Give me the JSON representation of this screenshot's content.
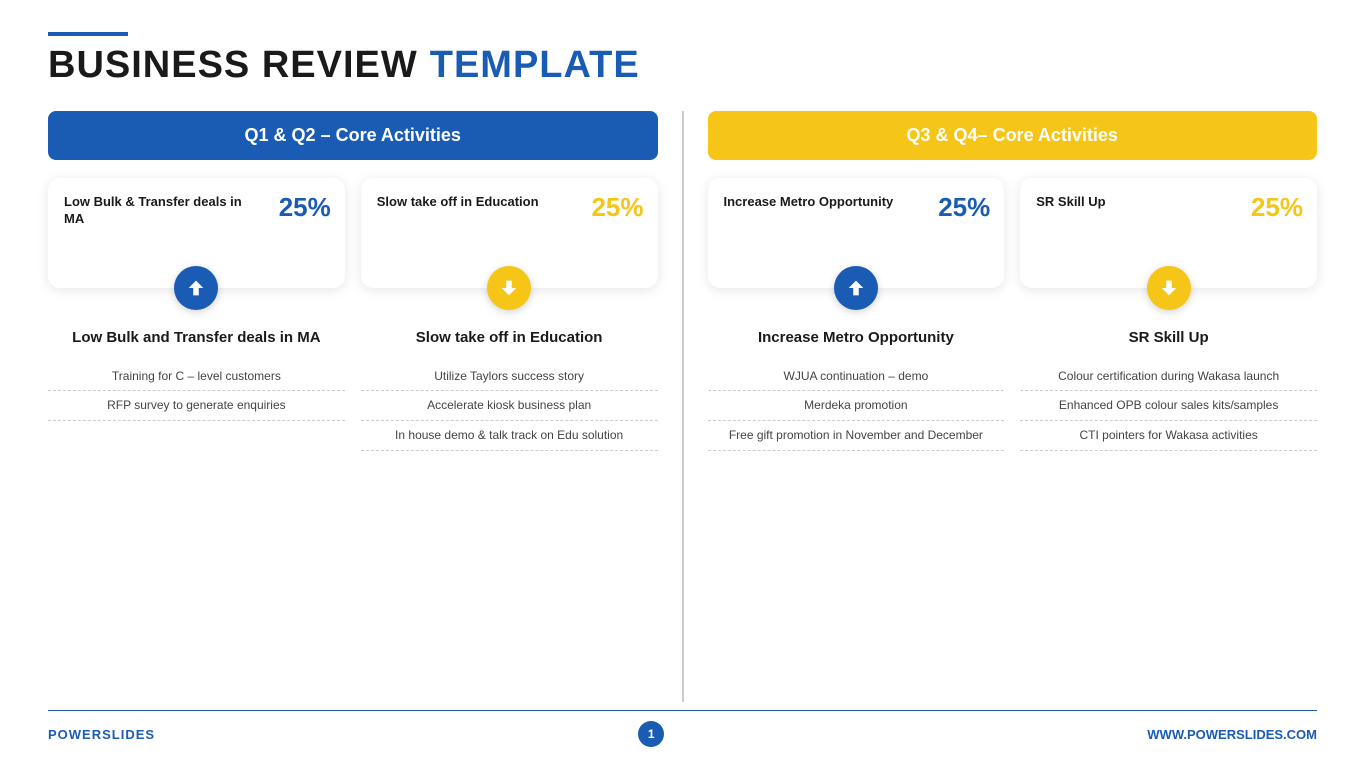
{
  "header": {
    "bar_accent": "#1a5cb4",
    "title_black": "BUSINESS REVIEW",
    "title_blue": "TEMPLATE"
  },
  "left_section": {
    "header": "Q1 & Q2 – Core Activities",
    "header_color": "blue",
    "cards": [
      {
        "label": "Low Bulk & Transfer deals in MA",
        "percent": "25%",
        "percent_color": "blue",
        "icon_type": "up",
        "icon_color": "blue"
      },
      {
        "label": "Slow take off in Education",
        "percent": "25%",
        "percent_color": "yellow",
        "icon_type": "down",
        "icon_color": "yellow"
      }
    ],
    "details": [
      {
        "title": "Low Bulk and Transfer deals in MA",
        "items": [
          "Training for C – level customers",
          "RFP survey to generate enquiries"
        ]
      },
      {
        "title": "Slow take off in Education",
        "items": [
          "Utilize Taylors success story",
          "Accelerate kiosk business plan",
          "In house demo & talk track on Edu solution"
        ]
      }
    ]
  },
  "right_section": {
    "header": "Q3 & Q4– Core Activities",
    "header_color": "yellow",
    "cards": [
      {
        "label": "Increase Metro Opportunity",
        "percent": "25%",
        "percent_color": "blue",
        "icon_type": "up",
        "icon_color": "blue"
      },
      {
        "label": "SR Skill Up",
        "percent": "25%",
        "percent_color": "yellow",
        "icon_type": "down",
        "icon_color": "yellow"
      }
    ],
    "details": [
      {
        "title": "Increase Metro Opportunity",
        "items": [
          "WJUA continuation – demo",
          "Merdeka promotion",
          "Free gift promotion in November and December"
        ]
      },
      {
        "title": "SR Skill Up",
        "items": [
          "Colour certification during Wakasa launch",
          "Enhanced OPB colour sales kits/samples",
          "CTI pointers for Wakasa activities"
        ]
      }
    ]
  },
  "footer": {
    "brand_black": "POWER",
    "brand_blue": "SLIDES",
    "page_number": "1",
    "url": "WWW.POWERSLIDES.COM"
  }
}
